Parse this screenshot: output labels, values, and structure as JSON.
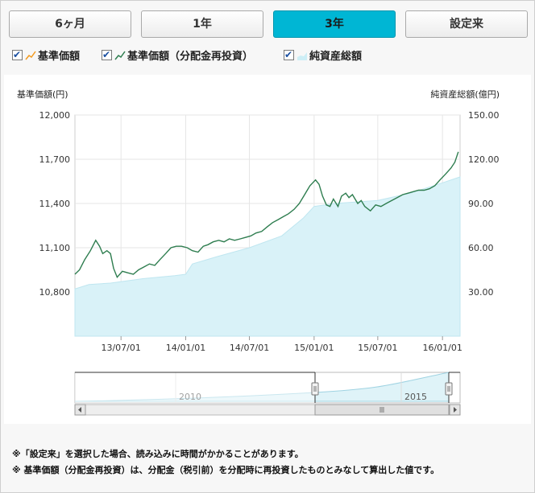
{
  "tabs": [
    {
      "label": "6ヶ月",
      "active": false
    },
    {
      "label": "1年",
      "active": false
    },
    {
      "label": "3年",
      "active": true
    },
    {
      "label": "設定来",
      "active": false
    }
  ],
  "legend": {
    "nav_label": "基準価額",
    "nav_reinvested_label": "基準価額（分配金再投資）",
    "net_assets_label": "純資産総額"
  },
  "colors": {
    "accent_tab": "#00b6d4",
    "nav_line": "#f39a1e",
    "nav_reinvested_line": "#2e7d4f",
    "net_assets_fill": "#d9f2f8"
  },
  "chart_data": {
    "type": "line",
    "left_axis_label": "基準価額(円)",
    "right_axis_label": "純資産総額(億円)",
    "left_ticks": [
      "12,000",
      "11,700",
      "11,400",
      "11,100",
      "10,800"
    ],
    "left_ylim": [
      10500,
      12000
    ],
    "right_ticks": [
      "150.00",
      "120.00",
      "90.00",
      "60.00",
      "30.00"
    ],
    "right_ylim": [
      0,
      150
    ],
    "x_ticks": [
      "13/07/01",
      "14/01/01",
      "14/07/01",
      "15/01/01",
      "15/07/01",
      "16/01/01"
    ],
    "x_tick_dates": [
      "2013-07-01",
      "2014-01-01",
      "2014-07-01",
      "2015-01-01",
      "2015-07-01",
      "2016-01-01"
    ],
    "x_range": [
      "2013-02-20",
      "2016-02-20"
    ],
    "grid": true,
    "series": [
      {
        "name": "基準価額（分配金再投資）",
        "style": "line",
        "axis": "left",
        "points": [
          [
            "2013-02-20",
            10920
          ],
          [
            "2013-03-05",
            10950
          ],
          [
            "2013-03-20",
            11020
          ],
          [
            "2013-04-05",
            11080
          ],
          [
            "2013-04-20",
            11150
          ],
          [
            "2013-05-01",
            11110
          ],
          [
            "2013-05-10",
            11060
          ],
          [
            "2013-05-22",
            11080
          ],
          [
            "2013-06-01",
            11060
          ],
          [
            "2013-06-10",
            10960
          ],
          [
            "2013-06-20",
            10900
          ],
          [
            "2013-07-05",
            10940
          ],
          [
            "2013-07-20",
            10930
          ],
          [
            "2013-08-05",
            10920
          ],
          [
            "2013-08-20",
            10950
          ],
          [
            "2013-09-05",
            10970
          ],
          [
            "2013-09-20",
            10990
          ],
          [
            "2013-10-05",
            10980
          ],
          [
            "2013-10-20",
            11020
          ],
          [
            "2013-11-05",
            11060
          ],
          [
            "2013-11-20",
            11100
          ],
          [
            "2013-12-05",
            11110
          ],
          [
            "2013-12-20",
            11110
          ],
          [
            "2014-01-05",
            11100
          ],
          [
            "2014-01-20",
            11080
          ],
          [
            "2014-02-05",
            11070
          ],
          [
            "2014-02-20",
            11110
          ],
          [
            "2014-03-05",
            11120
          ],
          [
            "2014-03-20",
            11140
          ],
          [
            "2014-04-05",
            11150
          ],
          [
            "2014-04-20",
            11140
          ],
          [
            "2014-05-05",
            11160
          ],
          [
            "2014-05-20",
            11150
          ],
          [
            "2014-06-05",
            11160
          ],
          [
            "2014-06-20",
            11170
          ],
          [
            "2014-07-05",
            11180
          ],
          [
            "2014-07-20",
            11200
          ],
          [
            "2014-08-05",
            11210
          ],
          [
            "2014-08-20",
            11240
          ],
          [
            "2014-09-05",
            11270
          ],
          [
            "2014-09-20",
            11290
          ],
          [
            "2014-10-05",
            11310
          ],
          [
            "2014-10-20",
            11330
          ],
          [
            "2014-11-05",
            11360
          ],
          [
            "2014-11-20",
            11400
          ],
          [
            "2014-12-05",
            11460
          ],
          [
            "2014-12-20",
            11520
          ],
          [
            "2015-01-05",
            11560
          ],
          [
            "2015-01-15",
            11530
          ],
          [
            "2015-01-25",
            11450
          ],
          [
            "2015-02-05",
            11390
          ],
          [
            "2015-02-15",
            11380
          ],
          [
            "2015-02-25",
            11430
          ],
          [
            "2015-03-10",
            11380
          ],
          [
            "2015-03-20",
            11450
          ],
          [
            "2015-04-01",
            11470
          ],
          [
            "2015-04-10",
            11440
          ],
          [
            "2015-04-20",
            11460
          ],
          [
            "2015-05-05",
            11400
          ],
          [
            "2015-05-15",
            11420
          ],
          [
            "2015-05-25",
            11380
          ],
          [
            "2015-06-10",
            11350
          ],
          [
            "2015-06-25",
            11390
          ],
          [
            "2015-07-10",
            11380
          ],
          [
            "2015-07-25",
            11400
          ],
          [
            "2015-08-10",
            11420
          ],
          [
            "2015-08-25",
            11440
          ],
          [
            "2015-09-10",
            11460
          ],
          [
            "2015-09-25",
            11470
          ],
          [
            "2015-10-10",
            11480
          ],
          [
            "2015-10-25",
            11490
          ],
          [
            "2015-11-10",
            11490
          ],
          [
            "2015-11-25",
            11500
          ],
          [
            "2015-12-10",
            11520
          ],
          [
            "2015-12-25",
            11560
          ],
          [
            "2016-01-10",
            11600
          ],
          [
            "2016-01-25",
            11640
          ],
          [
            "2016-02-05",
            11680
          ],
          [
            "2016-02-15",
            11750
          ]
        ]
      },
      {
        "name": "純資産総額",
        "style": "area",
        "axis": "right",
        "points": [
          [
            "2013-02-20",
            32
          ],
          [
            "2013-04-01",
            35
          ],
          [
            "2013-06-01",
            36
          ],
          [
            "2013-09-01",
            39
          ],
          [
            "2013-12-01",
            41
          ],
          [
            "2014-01-01",
            42
          ],
          [
            "2014-01-20",
            49
          ],
          [
            "2014-04-01",
            54
          ],
          [
            "2014-07-01",
            60
          ],
          [
            "2014-10-01",
            68
          ],
          [
            "2014-12-01",
            80
          ],
          [
            "2015-01-01",
            88
          ],
          [
            "2015-03-01",
            90
          ],
          [
            "2015-07-01",
            92
          ],
          [
            "2015-10-01",
            97
          ],
          [
            "2016-01-01",
            104
          ],
          [
            "2016-02-20",
            108
          ]
        ]
      }
    ],
    "navigator": {
      "label_left": "2010",
      "label_right": "2015"
    }
  },
  "notes": [
    "※「設定来」を選択した場合、読み込みに時間がかかることがあります。",
    "※ 基準価額（分配金再投資）は、分配金（税引前）を分配時に再投資したものとみなして算出した値です。"
  ]
}
